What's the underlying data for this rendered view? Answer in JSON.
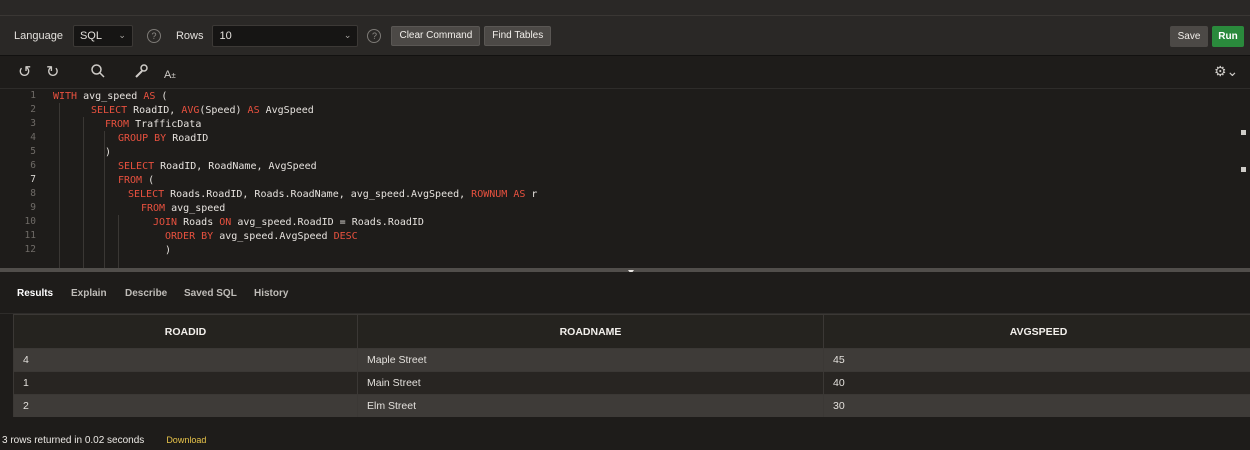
{
  "toolbar": {
    "language_label": "Language",
    "language_value": "SQL",
    "rows_label": "Rows",
    "rows_value": "10",
    "help_glyph": "?",
    "clear_command": "Clear Command",
    "find_tables": "Find Tables",
    "save": "Save",
    "run": "Run"
  },
  "editor_tools": {
    "undo_icon": "undo-icon",
    "redo_icon": "redo-icon",
    "search_icon": "search-icon",
    "format_icon": "wrench-icon",
    "font_size_label_big": "A",
    "font_size_label_small": "±",
    "settings_icon": "gear-icon"
  },
  "code": {
    "line_numbers": [
      "1",
      "2",
      "3",
      "4",
      "5",
      "6",
      "7",
      "8",
      "9",
      "10",
      "11",
      "12"
    ],
    "active_line": "7",
    "lines": [
      [
        {
          "k": true,
          "t": "WITH"
        },
        {
          "k": false,
          "t": " avg_speed "
        },
        {
          "k": true,
          "t": "AS"
        },
        {
          "k": false,
          "t": " ("
        }
      ],
      [
        {
          "k": true,
          "t": "SELECT"
        },
        {
          "k": false,
          "t": " RoadID, "
        },
        {
          "k": true,
          "t": "AVG"
        },
        {
          "k": false,
          "t": "(Speed) "
        },
        {
          "k": true,
          "t": "AS"
        },
        {
          "k": false,
          "t": " AvgSpeed"
        }
      ],
      [
        {
          "k": true,
          "t": "FROM"
        },
        {
          "k": false,
          "t": " TrafficData"
        }
      ],
      [
        {
          "k": true,
          "t": "GROUP BY"
        },
        {
          "k": false,
          "t": " RoadID"
        }
      ],
      [
        {
          "k": false,
          "t": ")"
        }
      ],
      [
        {
          "k": true,
          "t": "SELECT"
        },
        {
          "k": false,
          "t": " RoadID, RoadName, AvgSpeed"
        }
      ],
      [
        {
          "k": true,
          "t": "FROM"
        },
        {
          "k": false,
          "t": " ("
        }
      ],
      [
        {
          "k": true,
          "t": "SELECT"
        },
        {
          "k": false,
          "t": " Roads.RoadID, Roads.RoadName, avg_speed.AvgSpeed, "
        },
        {
          "k": true,
          "t": "ROWNUM"
        },
        {
          "k": false,
          "t": " "
        },
        {
          "k": true,
          "t": "AS"
        },
        {
          "k": false,
          "t": " r"
        }
      ],
      [
        {
          "k": true,
          "t": "FROM"
        },
        {
          "k": false,
          "t": " avg_speed"
        }
      ],
      [
        {
          "k": true,
          "t": "JOIN"
        },
        {
          "k": false,
          "t": " Roads "
        },
        {
          "k": true,
          "t": "ON"
        },
        {
          "k": false,
          "t": " avg_speed.RoadID = Roads.RoadID"
        }
      ],
      [
        {
          "k": true,
          "t": "ORDER BY"
        },
        {
          "k": false,
          "t": " avg_speed.AvgSpeed "
        },
        {
          "k": true,
          "t": "DESC"
        }
      ],
      [
        {
          "k": false,
          "t": ")"
        }
      ]
    ]
  },
  "tabs": [
    "Results",
    "Explain",
    "Describe",
    "Saved SQL",
    "History"
  ],
  "active_tab": "Results",
  "results": {
    "columns": [
      "ROADID",
      "ROADNAME",
      "AVGSPEED"
    ],
    "rows": [
      [
        "4",
        "Maple Street",
        "45"
      ],
      [
        "1",
        "Main Street",
        "40"
      ],
      [
        "2",
        "Elm Street",
        "30"
      ]
    ]
  },
  "footer": {
    "status": "3 rows returned in 0.02 seconds",
    "download": "Download"
  },
  "colors": {
    "keyword": "#e8513f",
    "run_button": "#2a8a3c",
    "download_link": "#e8c44a"
  }
}
